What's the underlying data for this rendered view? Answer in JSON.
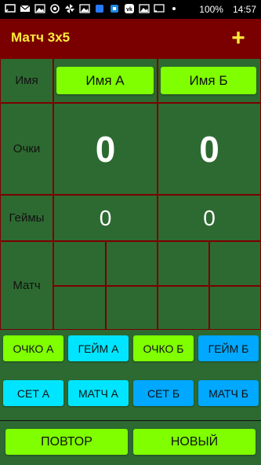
{
  "status_bar": {
    "battery": "100%",
    "time": "14:57"
  },
  "app_bar": {
    "title": "Матч 3х5",
    "add_label": "+"
  },
  "grid": {
    "row_labels": {
      "name": "Имя",
      "points": "Очки",
      "games": "Геймы",
      "match": "Матч"
    },
    "player_a": {
      "name": "Имя А",
      "points": "0",
      "games": "0"
    },
    "player_b": {
      "name": "Имя Б",
      "points": "0",
      "games": "0"
    }
  },
  "actions": {
    "point_a": "ОЧКО А",
    "game_a": "ГЕЙМ А",
    "point_b": "ОЧКО Б",
    "game_b": "ГЕЙМ Б",
    "set_a": "СЕТ А",
    "match_a": "МАТЧ А",
    "set_b": "СЕТ Б",
    "match_b": "МАТЧ Б",
    "repeat": "ПОВТОР",
    "new": "НОВЫЙ"
  },
  "colors": {
    "app_bar": "#7a0000",
    "title": "#ffeb3b",
    "field": "#2d6a31",
    "button_green": "#7fff00",
    "button_cyan": "#00e5ff",
    "button_blue": "#00a8ff"
  }
}
